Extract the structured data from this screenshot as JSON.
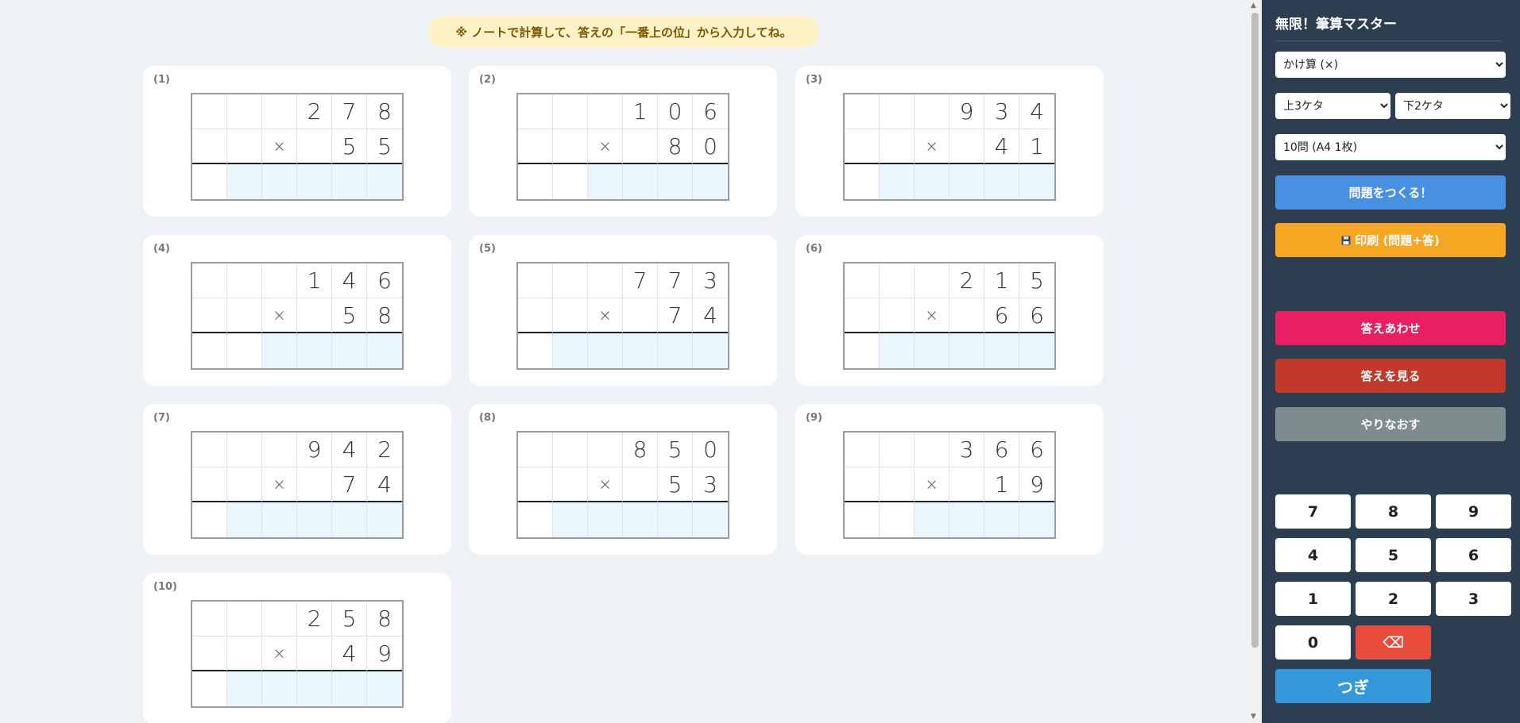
{
  "notice": "※ ノートで計算して、答えの「一番上の位」から入力してね。",
  "problems": [
    {
      "label": "(1)",
      "top": [
        "",
        "",
        "",
        "2",
        "7",
        "8"
      ],
      "mid": [
        "",
        "",
        "×",
        "",
        "5",
        "5"
      ],
      "ans": [
        false,
        true,
        true,
        true,
        true,
        true
      ]
    },
    {
      "label": "(2)",
      "top": [
        "",
        "",
        "",
        "1",
        "0",
        "6"
      ],
      "mid": [
        "",
        "",
        "×",
        "",
        "8",
        "0"
      ],
      "ans": [
        false,
        false,
        true,
        true,
        true,
        true
      ]
    },
    {
      "label": "(3)",
      "top": [
        "",
        "",
        "",
        "9",
        "3",
        "4"
      ],
      "mid": [
        "",
        "",
        "×",
        "",
        "4",
        "1"
      ],
      "ans": [
        false,
        true,
        true,
        true,
        true,
        true
      ]
    },
    {
      "label": "(4)",
      "top": [
        "",
        "",
        "",
        "1",
        "4",
        "6"
      ],
      "mid": [
        "",
        "",
        "×",
        "",
        "5",
        "8"
      ],
      "ans": [
        false,
        false,
        true,
        true,
        true,
        true
      ]
    },
    {
      "label": "(5)",
      "top": [
        "",
        "",
        "",
        "7",
        "7",
        "3"
      ],
      "mid": [
        "",
        "",
        "×",
        "",
        "7",
        "4"
      ],
      "ans": [
        false,
        true,
        true,
        true,
        true,
        true
      ]
    },
    {
      "label": "(6)",
      "top": [
        "",
        "",
        "",
        "2",
        "1",
        "5"
      ],
      "mid": [
        "",
        "",
        "×",
        "",
        "6",
        "6"
      ],
      "ans": [
        false,
        true,
        true,
        true,
        true,
        true
      ]
    },
    {
      "label": "(7)",
      "top": [
        "",
        "",
        "",
        "9",
        "4",
        "2"
      ],
      "mid": [
        "",
        "",
        "×",
        "",
        "7",
        "4"
      ],
      "ans": [
        false,
        true,
        true,
        true,
        true,
        true
      ]
    },
    {
      "label": "(8)",
      "top": [
        "",
        "",
        "",
        "8",
        "5",
        "0"
      ],
      "mid": [
        "",
        "",
        "×",
        "",
        "5",
        "3"
      ],
      "ans": [
        false,
        true,
        true,
        true,
        true,
        true
      ]
    },
    {
      "label": "(9)",
      "top": [
        "",
        "",
        "",
        "3",
        "6",
        "6"
      ],
      "mid": [
        "",
        "",
        "×",
        "",
        "1",
        "9"
      ],
      "ans": [
        false,
        false,
        true,
        true,
        true,
        true
      ]
    },
    {
      "label": "(10)",
      "top": [
        "",
        "",
        "",
        "2",
        "5",
        "8"
      ],
      "mid": [
        "",
        "",
        "×",
        "",
        "4",
        "9"
      ],
      "ans": [
        false,
        true,
        true,
        true,
        true,
        true
      ]
    }
  ],
  "sidebar": {
    "title": "無限！筆算マスター",
    "operation": "かけ算 (×)",
    "top_digits": "上3ケタ",
    "bottom_digits": "下2ケタ",
    "count": "10問 (A4 1枚)",
    "create_label": "問題をつくる！",
    "print_label": "印刷 (問題+答)",
    "check_label": "答えあわせ",
    "show_label": "答えを見る",
    "redo_label": "やりなおす",
    "backspace_label": "⌫",
    "next_label": "つぎ",
    "keys": [
      "7",
      "8",
      "9",
      "4",
      "5",
      "6",
      "1",
      "2",
      "3",
      "0"
    ]
  },
  "colors": {
    "sidebar_bg": "#2c3e50",
    "create": "#4a90e2",
    "print": "#f5a623",
    "check": "#e91e63",
    "show": "#c0392b",
    "redo": "#7f8c8d",
    "backspace": "#e74c3c",
    "next": "#3498db",
    "answer_cell": "#eaf6fe"
  }
}
